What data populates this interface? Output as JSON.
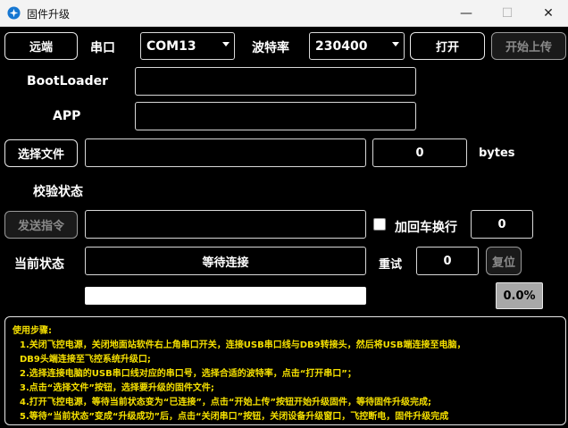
{
  "window": {
    "title": "固件升级",
    "minimize_glyph": "—",
    "maximize_glyph": "☐",
    "close_glyph": "✕"
  },
  "toolbar": {
    "remote_label": "远端",
    "port_label": "串口",
    "port_value": "COM13",
    "baud_label": "波特率",
    "baud_value": "230400",
    "open_label": "打开",
    "start_upload_label": "开始上传"
  },
  "fields": {
    "bootloader_label": "BootLoader",
    "bootloader_value": "",
    "app_label": "APP",
    "app_value": "",
    "select_file_label": "选择文件",
    "file_path_value": "",
    "file_size_value": "0",
    "file_size_unit": "bytes",
    "verify_status_label": "校验状态"
  },
  "command": {
    "send_label": "发送指令",
    "command_value": "",
    "crlf_label": "加回车换行",
    "crlf_checked": false,
    "count_value": "0"
  },
  "status": {
    "label": "当前状态",
    "value": "等待连接",
    "retry_label": "重试",
    "retry_value": "0",
    "reset_label": "复位"
  },
  "progress": {
    "fraction": 0.0,
    "percent_text": "0.0%"
  },
  "instructions": {
    "heading": "使用步骤:",
    "lines": [
      "1.关闭飞控电源，关闭地面站软件右上角串口开关，连接USB串口线与DB9转接头，然后将USB端连接至电脑，",
      "DB9头端连接至飞控系统升级口;",
      "2.选择连接电脑的USB串口线对应的串口号，选择合适的波特率，点击“打开串口”；",
      "3.点击“选择文件”按钮，选择要升级的固件文件;",
      "4.打开飞控电源，等待当前状态变为“已连接”，点击“开始上传”按钮开始升级固件，等待固件升级完成;",
      "5.等待“当前状态”变成“升级成功”后，点击“关闭串口”按钮，关闭设备升级窗口，飞控断电，固件升级完成"
    ]
  },
  "colors": {
    "background": "#000000",
    "instruction_text": "#f5e000",
    "percent_bg": "#a8a8a8"
  },
  "icons": {
    "app": "firmware-app-icon",
    "dropdown": "chevron-down-icon"
  }
}
